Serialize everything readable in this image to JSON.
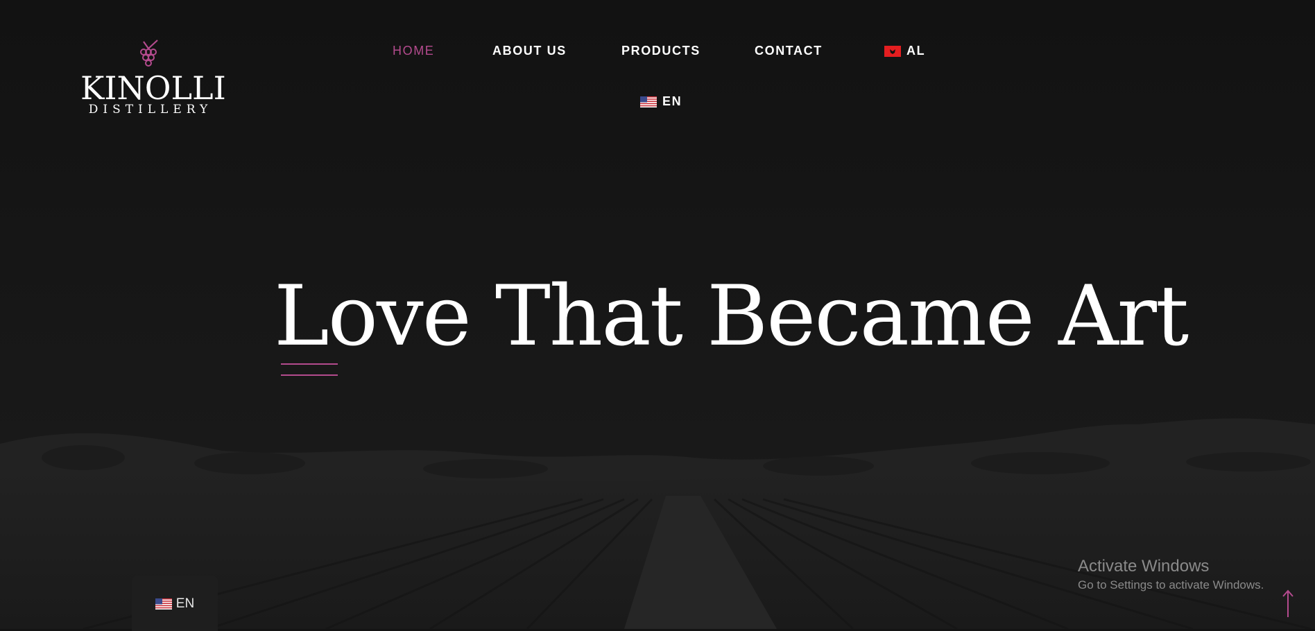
{
  "brand": {
    "name": "KINOLLI",
    "tagline": "DISTILLERY",
    "logo_icon": "grape-cluster-icon",
    "accent_color": "#b44b8e"
  },
  "nav": {
    "items": [
      {
        "label": "HOME",
        "active": true
      },
      {
        "label": "ABOUT US",
        "active": false
      },
      {
        "label": "PRODUCTS",
        "active": false
      },
      {
        "label": "CONTACT",
        "active": false
      }
    ],
    "lang_al": {
      "label": "AL",
      "icon": "albania-flag-icon"
    },
    "lang_en": {
      "label": "EN",
      "icon": "us-flag-icon"
    }
  },
  "hero": {
    "headline": "Love That Became Art"
  },
  "language_widget": {
    "label": "EN",
    "icon": "us-flag-icon"
  },
  "windows_watermark": {
    "title": "Activate Windows",
    "subtitle": "Go to Settings to activate Windows."
  },
  "scroll_top": {
    "icon": "arrow-up-icon"
  }
}
